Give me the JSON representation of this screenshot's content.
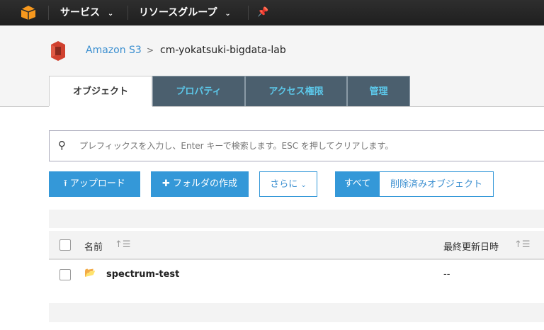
{
  "topbar": {
    "services": "サービス",
    "resource_groups": "リソースグループ"
  },
  "breadcrumb": {
    "root": "Amazon S3",
    "separator": ">",
    "bucket": "cm-yokatsuki-bigdata-lab"
  },
  "tabs": [
    {
      "label": "オブジェクト",
      "active": true
    },
    {
      "label": "プロパティ"
    },
    {
      "label": "アクセス権限"
    },
    {
      "label": "管理"
    }
  ],
  "search": {
    "placeholder": "プレフィックスを入力し、Enter キーで検索します。ESC を押してクリアします。"
  },
  "toolbar": {
    "upload": "アップロード",
    "create_folder": "フォルダの作成",
    "more": "さらに",
    "all": "すべて",
    "deleted": "削除済みオブジェクト"
  },
  "table": {
    "columns": [
      "名前",
      "最終更新日時"
    ],
    "rows": [
      {
        "name": "spectrum-test",
        "modified": "--",
        "type": "folder"
      }
    ]
  },
  "colors": {
    "accent": "#3498d8",
    "tab_bg": "#4b5f6e",
    "tab_text": "#5cc8ea",
    "s3_logo": "#d0412f"
  }
}
